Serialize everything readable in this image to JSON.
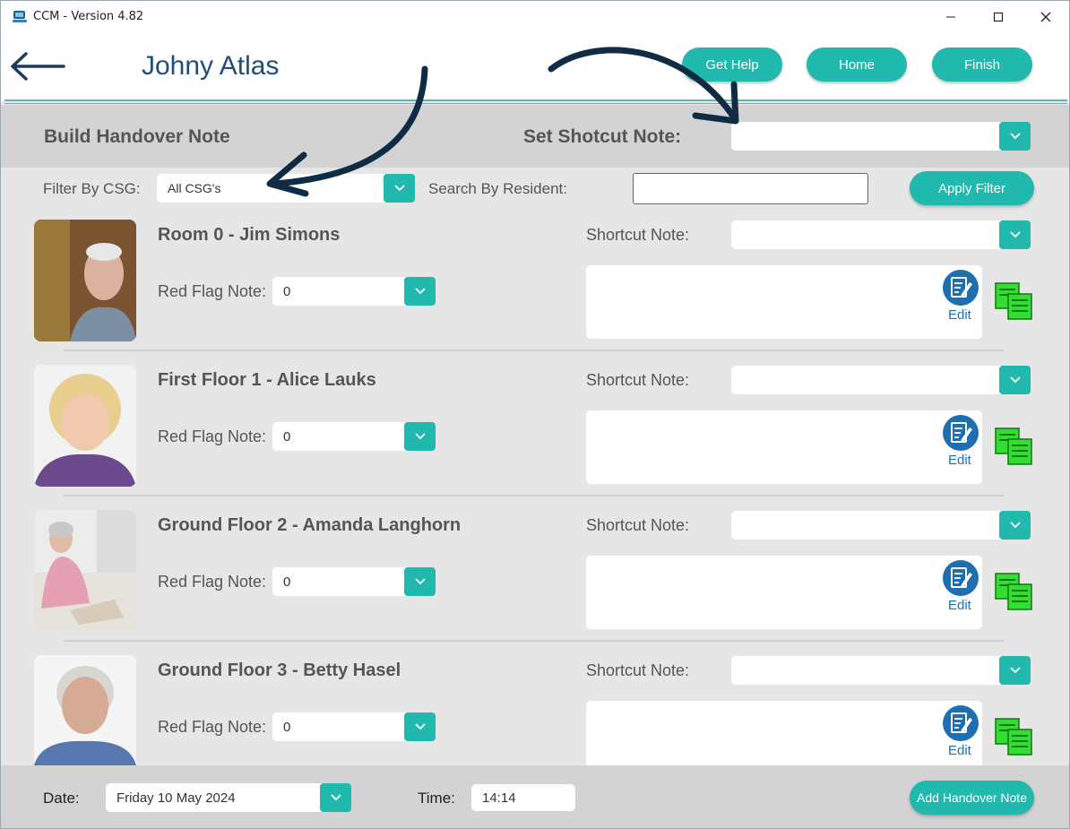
{
  "window": {
    "title": "CCM - Version 4.82"
  },
  "header": {
    "user_name": "Johny Atlas",
    "buttons": {
      "help": "Get Help",
      "home": "Home",
      "finish": "Finish"
    }
  },
  "section": {
    "title": "Build Handover Note",
    "shortcut_label": "Set Shotcut Note:",
    "shortcut_value": ""
  },
  "filters": {
    "csg_label": "Filter By CSG:",
    "csg_value": "All CSG's",
    "search_label": "Search By Resident:",
    "search_value": "",
    "apply_label": "Apply Filter"
  },
  "residents": [
    {
      "name": "Room 0 - Jim Simons",
      "shortcut_label": "Shortcut Note:",
      "shortcut_value": "",
      "red_flag_label": "Red Flag Note:",
      "red_flag_value": "0",
      "edit_label": "Edit",
      "note": ""
    },
    {
      "name": "First Floor 1 - Alice Lauks",
      "shortcut_label": "Shortcut Note:",
      "shortcut_value": "",
      "red_flag_label": "Red Flag Note:",
      "red_flag_value": "0",
      "edit_label": "Edit",
      "note": ""
    },
    {
      "name": "Ground Floor 2 - Amanda Langhorn",
      "shortcut_label": "Shortcut Note:",
      "shortcut_value": "",
      "red_flag_label": "Red Flag Note:",
      "red_flag_value": "0",
      "edit_label": "Edit",
      "note": ""
    },
    {
      "name": "Ground Floor 3 - Betty Hasel",
      "shortcut_label": "Shortcut Note:",
      "shortcut_value": "",
      "red_flag_label": "Red Flag Note:",
      "red_flag_value": "0",
      "edit_label": "Edit",
      "note": ""
    }
  ],
  "footer": {
    "date_label": "Date:",
    "date_value": "Friday 10 May 2024",
    "time_label": "Time:",
    "time_value": "14:14",
    "add_label": "Add Handover Note"
  },
  "colors": {
    "accent": "#21b9ad",
    "title_blue": "#1f4e79",
    "edit_blue": "#1f6fb0",
    "copy_green": "#33cc33"
  },
  "icons": [
    "app-icon",
    "minimize-icon",
    "maximize-icon",
    "close-icon",
    "back-arrow-icon",
    "chevron-down-icon",
    "edit-note-icon",
    "copy-notes-icon",
    "annotation-arrow-icon"
  ]
}
